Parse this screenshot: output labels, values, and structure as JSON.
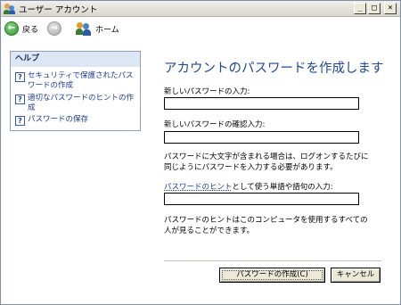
{
  "window": {
    "title": "ユーザー アカウント",
    "controls": [
      "_",
      "□",
      "×"
    ]
  },
  "toolbar": {
    "back_label": "戻る",
    "home_label": "ホーム"
  },
  "help": {
    "header": "ヘルプ",
    "items": [
      {
        "label": "セキュリティで保護されたパスワードの作成"
      },
      {
        "label": "適切なパスワードのヒントの作成"
      },
      {
        "label": "パスワードの保存"
      }
    ]
  },
  "main": {
    "title": "アカウントのパスワードを作成します",
    "new_password_label": "新しいパスワードの入力:",
    "new_password_value": "",
    "confirm_password_label": "新しいパスワードの確認入力:",
    "confirm_password_value": "",
    "case_note": "パスワードに大文字が含まれる場合は、ログオンするたびに同じようにパスワードを入力する必要があります。",
    "hint_label_link": "パスワードのヒント",
    "hint_label_rest": "として使う単語や語句の入力:",
    "hint_value": "",
    "hint_note": "パスワードのヒントはこのコンピュータを使用するすべての人が見ることができます。"
  },
  "buttons": {
    "create_label": "パスワードの作成(C)",
    "cancel_label": "キャンセル"
  },
  "colors": {
    "accent": "#1e4a96",
    "link": "#1d3a96",
    "panel_header": "#dde6f5"
  }
}
